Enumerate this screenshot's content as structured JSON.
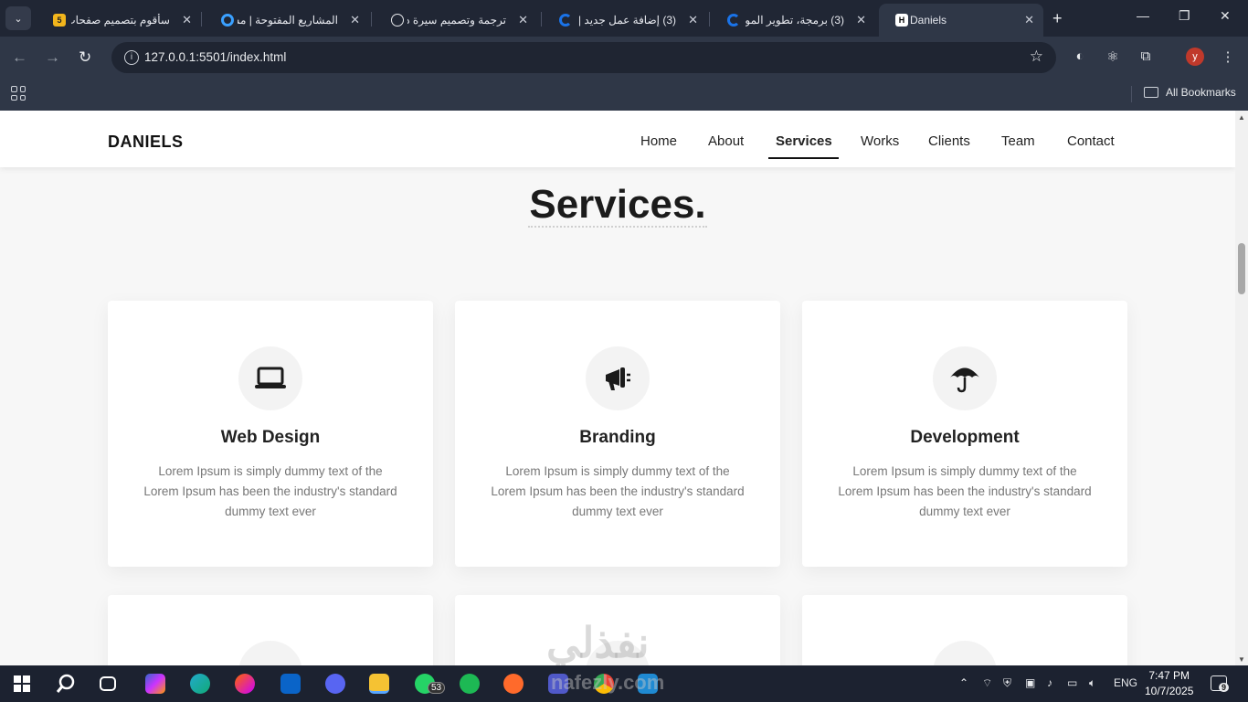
{
  "browser": {
    "tabs": [
      {
        "title": "سأقوم بتصميم صفحات",
        "favicon_text": "5",
        "favicon_color": "#f2b51c"
      },
      {
        "title": "المشاريع المفتوحة | مس",
        "favicon_color": "#1a73e8"
      },
      {
        "title": "ترجمة وتصميم سيرة ذا",
        "favicon_color": "#e8eaed"
      },
      {
        "title": "(3) إضافة عمل جديد |",
        "favicon_color": "#1a73e8"
      },
      {
        "title": "(3) برمجة، تطوير الموا",
        "favicon_color": "#1a73e8"
      },
      {
        "title": "Daniels",
        "favicon_text": "H",
        "active": true
      }
    ],
    "url": "127.0.0.1:5501/index.html",
    "profile_initial": "y",
    "bookmarks_label": "All Bookmarks"
  },
  "site": {
    "logo": "DANIELS",
    "nav": [
      "Home",
      "About",
      "Services",
      "Works",
      "Clients",
      "Team",
      "Contact"
    ],
    "active_nav": "Services",
    "section_title": "Services.",
    "cards": [
      {
        "title": "Web Design",
        "icon": "laptop-icon",
        "text": "Lorem Ipsum is simply dummy text of the Lorem Ipsum has been the industry's standard dummy text ever"
      },
      {
        "title": "Branding",
        "icon": "megaphone-icon",
        "text": "Lorem Ipsum is simply dummy text of the Lorem Ipsum has been the industry's standard dummy text ever"
      },
      {
        "title": "Development",
        "icon": "umbrella-icon",
        "text": "Lorem Ipsum is simply dummy text of the Lorem Ipsum has been the industry's standard dummy text ever"
      }
    ]
  },
  "watermark": "نفذلي",
  "watermark_latin": "nafezly.com",
  "taskbar": {
    "whatsapp_badge": "53",
    "language": "ENG",
    "time": "7:47 PM",
    "date": "10/7/2025",
    "notifications": "9"
  }
}
